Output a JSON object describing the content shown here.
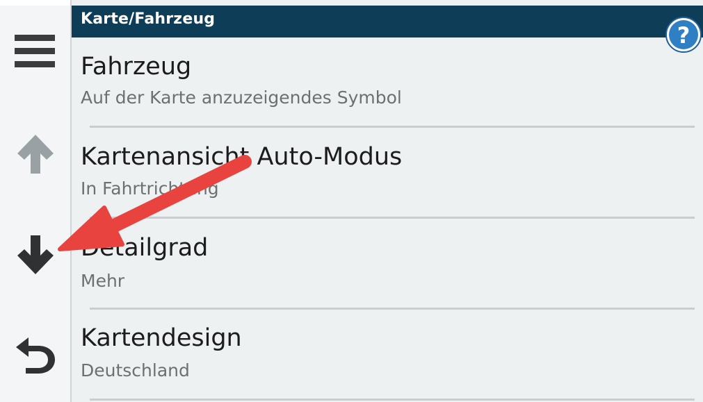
{
  "header": {
    "title": "Karte/Fahrzeug"
  },
  "help_button": {
    "icon": "help-icon",
    "glyph": "?"
  },
  "rail": {
    "menu_icon": "menu-icon",
    "up_icon": "arrow-up-icon",
    "down_icon": "arrow-down-icon",
    "back_icon": "back-icon"
  },
  "list": {
    "items": [
      {
        "title": "Fahrzeug",
        "subtitle": "Auf der Karte anzuzeigendes Symbol"
      },
      {
        "title": "Kartenansicht Auto-Modus",
        "subtitle": "In Fahrtrichtung"
      },
      {
        "title": "Detailgrad",
        "subtitle": "Mehr"
      },
      {
        "title": "Kartendesign",
        "subtitle": "Deutschland"
      }
    ]
  },
  "colors": {
    "header_bg": "#0e3e57",
    "list_bg": "#eef1f2",
    "annotation_arrow": "#e8433f",
    "help_blue": "#2f7fc4"
  }
}
